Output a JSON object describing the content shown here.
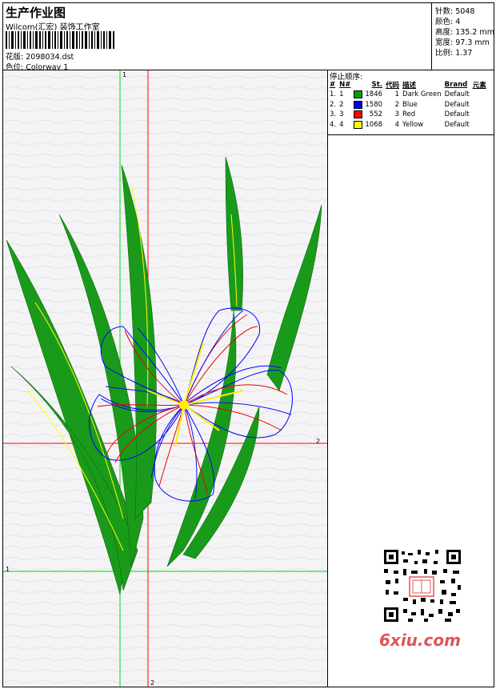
{
  "header": {
    "title": "生产作业图",
    "company": "Wilcom(汇宏) 装饰工作室",
    "file_label": "花版:",
    "file_value": "2098034.dst",
    "color_label": "色位:",
    "color_value": "Colorway 1"
  },
  "stats": {
    "stitches": "针数: 5048",
    "colors": "颜色: 4",
    "height": "高度: 135.2 mm",
    "width": "宽度: 97.3 mm",
    "scale": "比例: 1.37"
  },
  "stop_sequence": {
    "title": "停止顺序:",
    "headers": [
      "#",
      "N#",
      "St.",
      "代码",
      "描述",
      "Brand",
      "元素"
    ],
    "rows": [
      {
        "idx": "1.",
        "n": "1",
        "color": "#00a000",
        "st": "1846",
        "code": "1",
        "desc": "Dark Green",
        "brand": "Default"
      },
      {
        "idx": "2.",
        "n": "2",
        "color": "#0000ff",
        "st": "1580",
        "code": "2",
        "desc": "Blue",
        "brand": "Default"
      },
      {
        "idx": "3.",
        "n": "3",
        "color": "#ff0000",
        "st": "552",
        "code": "3",
        "desc": "Red",
        "brand": "Default"
      },
      {
        "idx": "4.",
        "n": "4",
        "color": "#ffff00",
        "st": "1068",
        "code": "4",
        "desc": "Yellow",
        "brand": "Default"
      }
    ]
  },
  "guides": {
    "label_1": "1",
    "label_2": "2"
  },
  "watermark": "6xiu.com"
}
